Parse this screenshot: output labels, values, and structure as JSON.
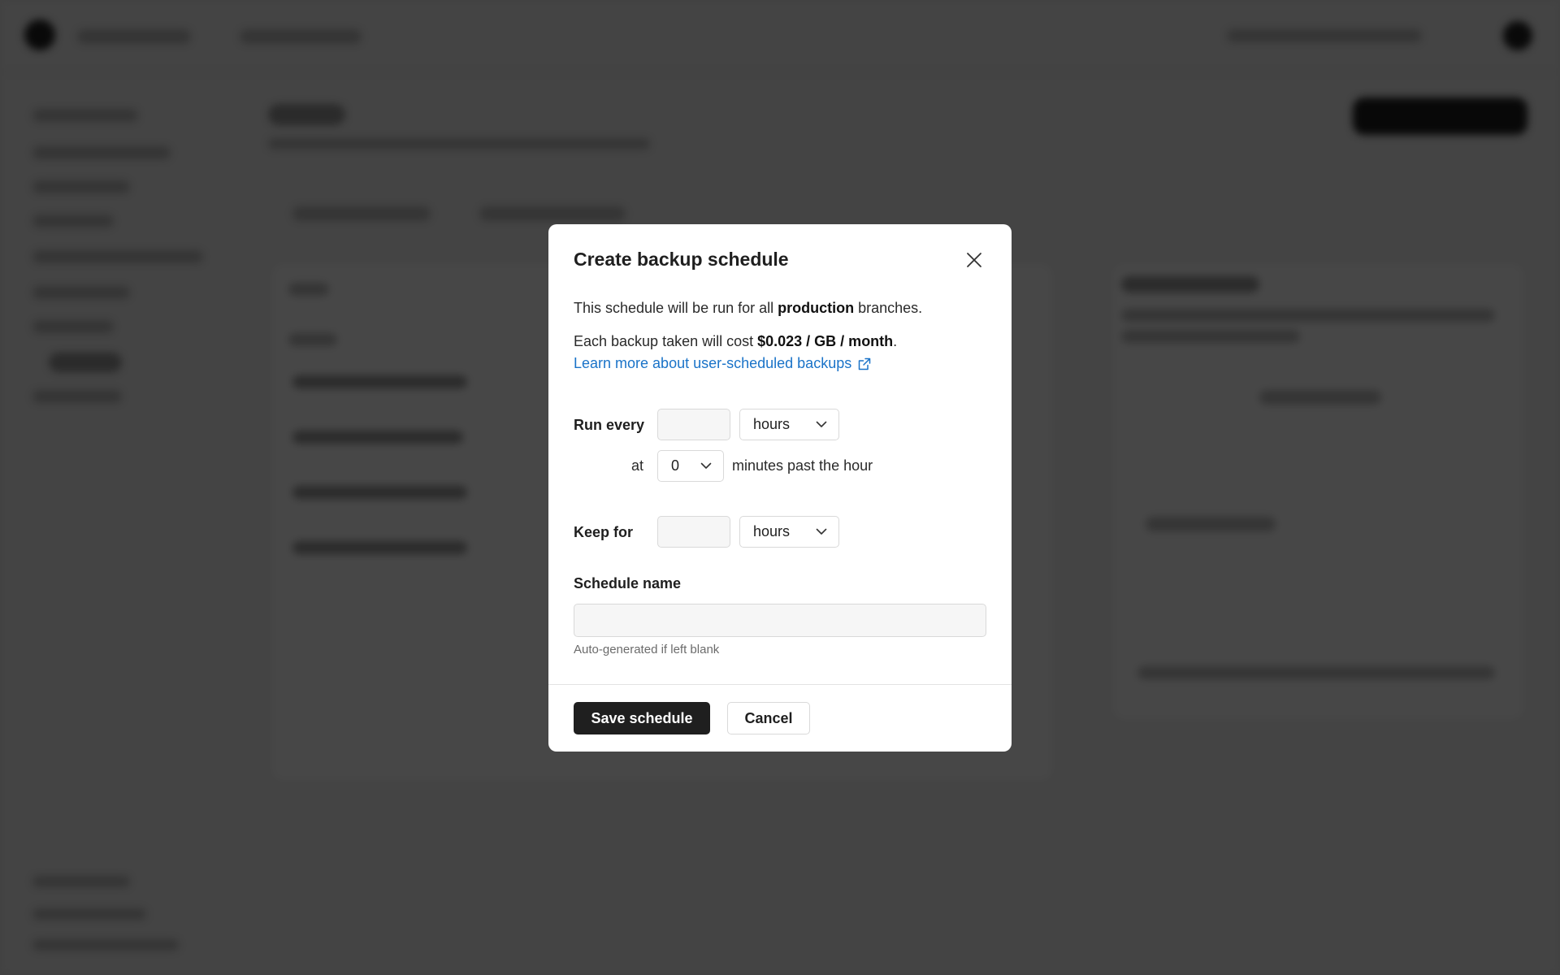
{
  "modal": {
    "title": "Create backup schedule",
    "close_icon": "close-icon",
    "line1_prefix": "This schedule will be run for all ",
    "line1_bold": "production",
    "line1_suffix": " branches.",
    "line2_prefix": "Each backup taken will cost ",
    "line2_bold": "$0.023 / GB / month",
    "line2_suffix": ".",
    "link_text": "Learn more about user-scheduled backups",
    "link_icon": "external-link-icon",
    "link_color": "#1a73c8"
  },
  "form": {
    "run_every_label": "Run every",
    "run_every_value": "",
    "run_every_unit": "hours",
    "at_label": "at",
    "minute_value": "0",
    "minutes_suffix": "minutes past the hour",
    "keep_for_label": "Keep for",
    "keep_for_value": "",
    "keep_for_unit": "hours",
    "schedule_name_label": "Schedule name",
    "schedule_name_value": "",
    "schedule_name_hint": "Auto-generated if left blank"
  },
  "actions": {
    "save_label": "Save schedule",
    "cancel_label": "Cancel",
    "primary_color": "#1f1f1f"
  },
  "overlay_color": "rgba(0,0,0,0.72)"
}
